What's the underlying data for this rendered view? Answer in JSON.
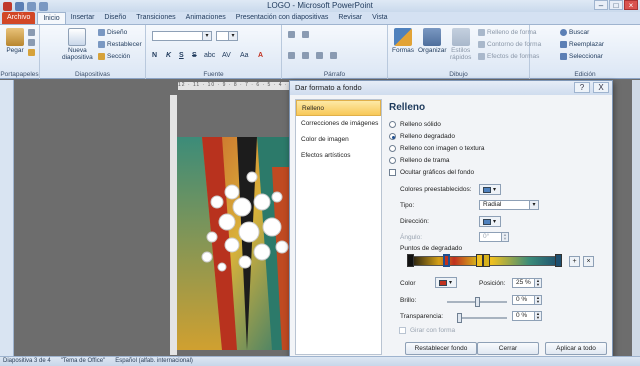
{
  "window": {
    "title": "LOGO - Microsoft PowerPoint"
  },
  "tabs": [
    "Archivo",
    "Inicio",
    "Insertar",
    "Diseño",
    "Transiciones",
    "Animaciones",
    "Presentación con diapositivas",
    "Revisar",
    "Vista"
  ],
  "ribbon": {
    "portapapeles": {
      "paste": "Pegar",
      "label": "Portapapeles"
    },
    "diapositivas": {
      "new_slide_1": "Nueva",
      "new_slide_2": "diapositiva",
      "layout": "Diseño",
      "reset": "Restablecer",
      "section": "Sección",
      "label": "Diapositivas"
    },
    "fuente": {
      "label": "Fuente",
      "bold": "N",
      "italic": "K",
      "underline": "S",
      "strike": "S",
      "shadow": "abc",
      "spacing": "AV",
      "case": "Aa",
      "color": "A"
    },
    "parrafo": {
      "label": "Párrafo"
    },
    "dibujo": {
      "shapes": "Formas",
      "arrange": "Organizar",
      "quick_styles_1": "Estilos",
      "quick_styles_2": "rápidos",
      "fill": "Relleno de forma",
      "outline": "Contorno de forma",
      "effects": "Efectos de formas",
      "label": "Dibujo"
    },
    "edicion": {
      "find": "Buscar",
      "replace": "Reemplazar",
      "select": "Seleccionar",
      "label": "Edición"
    }
  },
  "ruler": {
    "marks": "12 · 11 · 10 · 9 · 8 · 7 · 6 · 5 · 4 · 3"
  },
  "status": {
    "slide": "Diapositiva 3 de 4",
    "theme": "\"Tema de Office\"",
    "language": "Español (alfab. internacional)"
  },
  "dialog": {
    "title": "Dar formato a fondo",
    "help": "?",
    "close": "X",
    "nav": [
      "Relleno",
      "Correcciones de imágenes",
      "Color de imagen",
      "Efectos artísticos"
    ],
    "section": "Relleno",
    "fill_options": [
      "Relleno sólido",
      "Relleno degradado",
      "Relleno con imagen o textura",
      "Relleno de trama"
    ],
    "selected_fill": "Relleno degradado",
    "hide_graphics": "Ocultar gráficos del fondo",
    "preset_colors": "Colores preestablecidos:",
    "type_label": "Tipo:",
    "type_value": "Radial",
    "direction_label": "Dirección:",
    "angle_label": "Ángulo:",
    "angle_value": "0°",
    "gradient_stops": "Puntos de degradado",
    "color_label": "Color",
    "position_label": "Posición:",
    "position_value": "25 %",
    "brightness_label": "Brillo:",
    "brightness_value": "0 %",
    "transparency_label": "Transparencia:",
    "transparency_value": "0 %",
    "rotate_with_shape": "Girar con forma",
    "buttons": {
      "reset": "Restablecer fondo",
      "close": "Cerrar",
      "apply_all": "Aplicar a todo"
    }
  },
  "colors": {
    "accent": "#d24726",
    "selection": "#f8c858",
    "swatch": "#4f81bd"
  }
}
